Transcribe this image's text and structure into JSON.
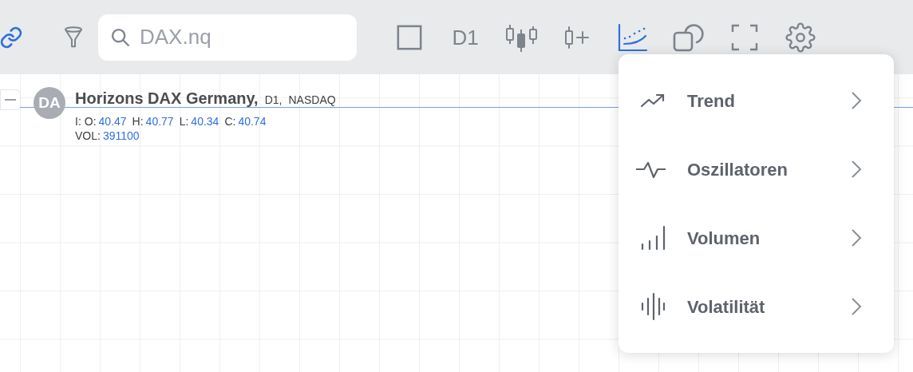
{
  "toolbar": {
    "left_tools": [
      {
        "kind": "link",
        "active": true
      },
      {
        "kind": "filter",
        "active": false
      }
    ],
    "search": {
      "placeholder": "DAX.nq"
    },
    "tools": [
      {
        "kind": "box",
        "active": false
      },
      {
        "kind": "timeframe",
        "label": "D1",
        "active": false
      },
      {
        "kind": "candles",
        "active": false
      },
      {
        "kind": "add_candle",
        "active": false
      },
      {
        "kind": "indicators",
        "active": true
      },
      {
        "kind": "shapes",
        "active": false
      },
      {
        "kind": "fullscreen",
        "active": false
      },
      {
        "kind": "settings",
        "active": false
      }
    ]
  },
  "legend": {
    "avatar": "DA",
    "name": "Horizons DAX Germany,",
    "timeframe": "D1,",
    "exchange": "NASDAQ",
    "prefix": "I:",
    "prices": [
      {
        "label": "O:",
        "value": "40.47"
      },
      {
        "label": "H:",
        "value": "40.77"
      },
      {
        "label": "L:",
        "value": "40.34"
      },
      {
        "label": "C:",
        "value": "40.74"
      }
    ],
    "volume": {
      "label": "VOL:",
      "value": "391100"
    }
  },
  "indicator_menu": [
    {
      "kind": "trend",
      "label": "Trend"
    },
    {
      "kind": "oscillator",
      "label": "Oszillatoren"
    },
    {
      "kind": "volume",
      "label": "Volumen"
    },
    {
      "kind": "volatility",
      "label": "Volatilität"
    }
  ]
}
